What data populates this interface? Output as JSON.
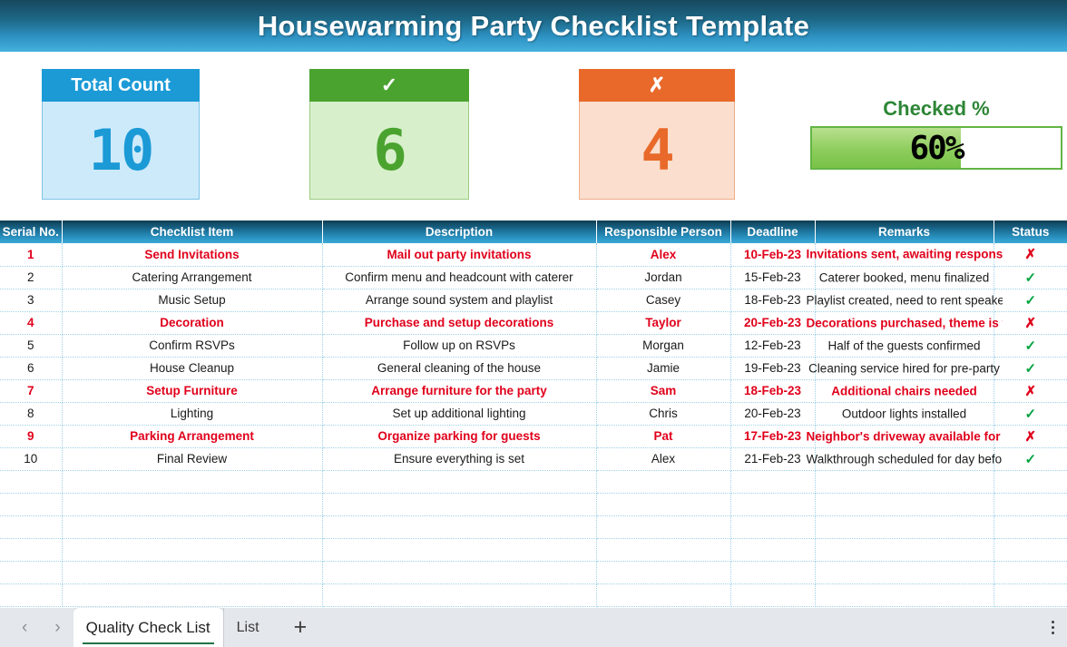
{
  "title": "Housewarming Party Checklist Template",
  "colors": {
    "title_gradient_start": "#17485d",
    "title_gradient_end": "#45b0dd",
    "total_accent": "#1b9ad6",
    "checked_accent": "#4ba32f",
    "unchecked_accent": "#e8692a",
    "percent_accent": "#62b545",
    "flag_red": "#e0001b",
    "status_green": "#00a33f"
  },
  "kpis": {
    "total": {
      "label": "Total Count",
      "value": "10"
    },
    "checked": {
      "label": "✓",
      "icon": "check-icon",
      "value": "6"
    },
    "unchecked": {
      "label": "✗",
      "icon": "cross-icon",
      "value": "4"
    },
    "percent": {
      "label": "Checked %",
      "value": "60%",
      "fill_percent": 60
    }
  },
  "table": {
    "headers": [
      "Serial No.",
      "Checklist Item",
      "Description",
      "Responsible Person",
      "Deadline",
      "Remarks",
      "Status"
    ],
    "rows": [
      {
        "serial": "1",
        "item": "Send Invitations",
        "description": "Mail out party invitations",
        "responsible": "Alex",
        "deadline": "10-Feb-23",
        "remarks": "Invitations sent, awaiting responses",
        "status": "✗",
        "status_kind": "no",
        "flagged": true
      },
      {
        "serial": "2",
        "item": "Catering Arrangement",
        "description": "Confirm menu and headcount with caterer",
        "responsible": "Jordan",
        "deadline": "15-Feb-23",
        "remarks": "Caterer booked, menu finalized",
        "status": "✓",
        "status_kind": "yes",
        "flagged": false
      },
      {
        "serial": "3",
        "item": "Music Setup",
        "description": "Arrange sound system and playlist",
        "responsible": "Casey",
        "deadline": "18-Feb-23",
        "remarks": "Playlist created, need to rent speakers",
        "status": "✓",
        "status_kind": "yes",
        "flagged": false
      },
      {
        "serial": "4",
        "item": "Decoration",
        "description": "Purchase and setup decorations",
        "responsible": "Taylor",
        "deadline": "20-Feb-23",
        "remarks": "Decorations purchased, theme is tropical",
        "status": "✗",
        "status_kind": "no",
        "flagged": true
      },
      {
        "serial": "5",
        "item": "Confirm RSVPs",
        "description": "Follow up on RSVPs",
        "responsible": "Morgan",
        "deadline": "12-Feb-23",
        "remarks": "Half of the guests confirmed",
        "status": "✓",
        "status_kind": "yes",
        "flagged": false
      },
      {
        "serial": "6",
        "item": "House Cleanup",
        "description": "General cleaning of the house",
        "responsible": "Jamie",
        "deadline": "19-Feb-23",
        "remarks": "Cleaning service hired for pre-party",
        "status": "✓",
        "status_kind": "yes",
        "flagged": false
      },
      {
        "serial": "7",
        "item": "Setup Furniture",
        "description": "Arrange furniture for the party",
        "responsible": "Sam",
        "deadline": "18-Feb-23",
        "remarks": "Additional chairs needed",
        "status": "✗",
        "status_kind": "no",
        "flagged": true
      },
      {
        "serial": "8",
        "item": "Lighting",
        "description": "Set up additional lighting",
        "responsible": "Chris",
        "deadline": "20-Feb-23",
        "remarks": "Outdoor lights installed",
        "status": "✓",
        "status_kind": "yes",
        "flagged": false
      },
      {
        "serial": "9",
        "item": "Parking Arrangement",
        "description": "Organize parking for guests",
        "responsible": "Pat",
        "deadline": "17-Feb-23",
        "remarks": "Neighbor's driveway available for use",
        "status": "✗",
        "status_kind": "no",
        "flagged": true
      },
      {
        "serial": "10",
        "item": "Final Review",
        "description": "Ensure everything is set",
        "responsible": "Alex",
        "deadline": "21-Feb-23",
        "remarks": "Walkthrough scheduled for day before",
        "status": "✓",
        "status_kind": "yes",
        "flagged": false
      }
    ],
    "blank_rows": 6
  },
  "sheet_bar": {
    "prev_arrow": "‹",
    "next_arrow": "›",
    "tabs": [
      {
        "label": "Quality Check List",
        "active": true
      },
      {
        "label": "List",
        "active": false
      }
    ],
    "add_label": "+",
    "menu_label": "⋮"
  }
}
